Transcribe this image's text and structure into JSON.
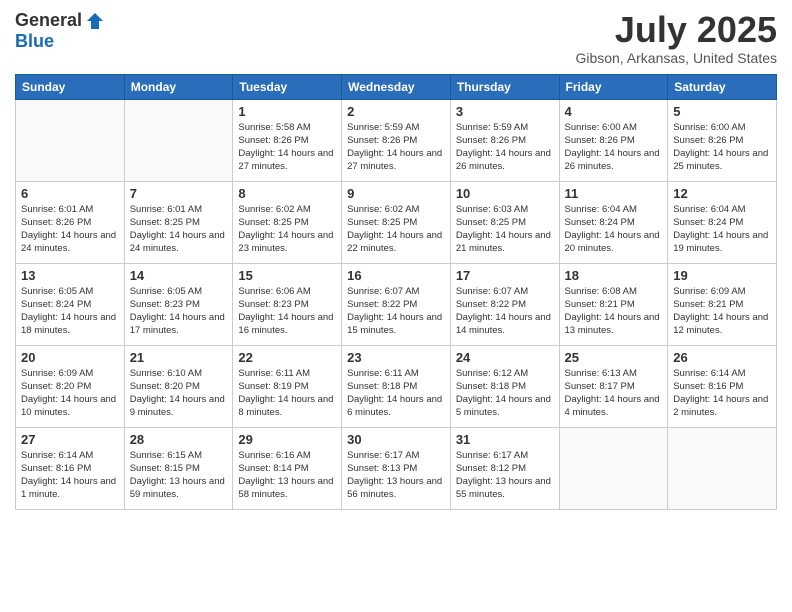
{
  "header": {
    "logo_general": "General",
    "logo_blue": "Blue",
    "month_title": "July 2025",
    "location": "Gibson, Arkansas, United States"
  },
  "weekdays": [
    "Sunday",
    "Monday",
    "Tuesday",
    "Wednesday",
    "Thursday",
    "Friday",
    "Saturday"
  ],
  "weeks": [
    [
      {
        "day": "",
        "sunrise": "",
        "sunset": "",
        "daylight": ""
      },
      {
        "day": "",
        "sunrise": "",
        "sunset": "",
        "daylight": ""
      },
      {
        "day": "1",
        "sunrise": "Sunrise: 5:58 AM",
        "sunset": "Sunset: 8:26 PM",
        "daylight": "Daylight: 14 hours and 27 minutes."
      },
      {
        "day": "2",
        "sunrise": "Sunrise: 5:59 AM",
        "sunset": "Sunset: 8:26 PM",
        "daylight": "Daylight: 14 hours and 27 minutes."
      },
      {
        "day": "3",
        "sunrise": "Sunrise: 5:59 AM",
        "sunset": "Sunset: 8:26 PM",
        "daylight": "Daylight: 14 hours and 26 minutes."
      },
      {
        "day": "4",
        "sunrise": "Sunrise: 6:00 AM",
        "sunset": "Sunset: 8:26 PM",
        "daylight": "Daylight: 14 hours and 26 minutes."
      },
      {
        "day": "5",
        "sunrise": "Sunrise: 6:00 AM",
        "sunset": "Sunset: 8:26 PM",
        "daylight": "Daylight: 14 hours and 25 minutes."
      }
    ],
    [
      {
        "day": "6",
        "sunrise": "Sunrise: 6:01 AM",
        "sunset": "Sunset: 8:26 PM",
        "daylight": "Daylight: 14 hours and 24 minutes."
      },
      {
        "day": "7",
        "sunrise": "Sunrise: 6:01 AM",
        "sunset": "Sunset: 8:25 PM",
        "daylight": "Daylight: 14 hours and 24 minutes."
      },
      {
        "day": "8",
        "sunrise": "Sunrise: 6:02 AM",
        "sunset": "Sunset: 8:25 PM",
        "daylight": "Daylight: 14 hours and 23 minutes."
      },
      {
        "day": "9",
        "sunrise": "Sunrise: 6:02 AM",
        "sunset": "Sunset: 8:25 PM",
        "daylight": "Daylight: 14 hours and 22 minutes."
      },
      {
        "day": "10",
        "sunrise": "Sunrise: 6:03 AM",
        "sunset": "Sunset: 8:25 PM",
        "daylight": "Daylight: 14 hours and 21 minutes."
      },
      {
        "day": "11",
        "sunrise": "Sunrise: 6:04 AM",
        "sunset": "Sunset: 8:24 PM",
        "daylight": "Daylight: 14 hours and 20 minutes."
      },
      {
        "day": "12",
        "sunrise": "Sunrise: 6:04 AM",
        "sunset": "Sunset: 8:24 PM",
        "daylight": "Daylight: 14 hours and 19 minutes."
      }
    ],
    [
      {
        "day": "13",
        "sunrise": "Sunrise: 6:05 AM",
        "sunset": "Sunset: 8:24 PM",
        "daylight": "Daylight: 14 hours and 18 minutes."
      },
      {
        "day": "14",
        "sunrise": "Sunrise: 6:05 AM",
        "sunset": "Sunset: 8:23 PM",
        "daylight": "Daylight: 14 hours and 17 minutes."
      },
      {
        "day": "15",
        "sunrise": "Sunrise: 6:06 AM",
        "sunset": "Sunset: 8:23 PM",
        "daylight": "Daylight: 14 hours and 16 minutes."
      },
      {
        "day": "16",
        "sunrise": "Sunrise: 6:07 AM",
        "sunset": "Sunset: 8:22 PM",
        "daylight": "Daylight: 14 hours and 15 minutes."
      },
      {
        "day": "17",
        "sunrise": "Sunrise: 6:07 AM",
        "sunset": "Sunset: 8:22 PM",
        "daylight": "Daylight: 14 hours and 14 minutes."
      },
      {
        "day": "18",
        "sunrise": "Sunrise: 6:08 AM",
        "sunset": "Sunset: 8:21 PM",
        "daylight": "Daylight: 14 hours and 13 minutes."
      },
      {
        "day": "19",
        "sunrise": "Sunrise: 6:09 AM",
        "sunset": "Sunset: 8:21 PM",
        "daylight": "Daylight: 14 hours and 12 minutes."
      }
    ],
    [
      {
        "day": "20",
        "sunrise": "Sunrise: 6:09 AM",
        "sunset": "Sunset: 8:20 PM",
        "daylight": "Daylight: 14 hours and 10 minutes."
      },
      {
        "day": "21",
        "sunrise": "Sunrise: 6:10 AM",
        "sunset": "Sunset: 8:20 PM",
        "daylight": "Daylight: 14 hours and 9 minutes."
      },
      {
        "day": "22",
        "sunrise": "Sunrise: 6:11 AM",
        "sunset": "Sunset: 8:19 PM",
        "daylight": "Daylight: 14 hours and 8 minutes."
      },
      {
        "day": "23",
        "sunrise": "Sunrise: 6:11 AM",
        "sunset": "Sunset: 8:18 PM",
        "daylight": "Daylight: 14 hours and 6 minutes."
      },
      {
        "day": "24",
        "sunrise": "Sunrise: 6:12 AM",
        "sunset": "Sunset: 8:18 PM",
        "daylight": "Daylight: 14 hours and 5 minutes."
      },
      {
        "day": "25",
        "sunrise": "Sunrise: 6:13 AM",
        "sunset": "Sunset: 8:17 PM",
        "daylight": "Daylight: 14 hours and 4 minutes."
      },
      {
        "day": "26",
        "sunrise": "Sunrise: 6:14 AM",
        "sunset": "Sunset: 8:16 PM",
        "daylight": "Daylight: 14 hours and 2 minutes."
      }
    ],
    [
      {
        "day": "27",
        "sunrise": "Sunrise: 6:14 AM",
        "sunset": "Sunset: 8:16 PM",
        "daylight": "Daylight: 14 hours and 1 minute."
      },
      {
        "day": "28",
        "sunrise": "Sunrise: 6:15 AM",
        "sunset": "Sunset: 8:15 PM",
        "daylight": "Daylight: 13 hours and 59 minutes."
      },
      {
        "day": "29",
        "sunrise": "Sunrise: 6:16 AM",
        "sunset": "Sunset: 8:14 PM",
        "daylight": "Daylight: 13 hours and 58 minutes."
      },
      {
        "day": "30",
        "sunrise": "Sunrise: 6:17 AM",
        "sunset": "Sunset: 8:13 PM",
        "daylight": "Daylight: 13 hours and 56 minutes."
      },
      {
        "day": "31",
        "sunrise": "Sunrise: 6:17 AM",
        "sunset": "Sunset: 8:12 PM",
        "daylight": "Daylight: 13 hours and 55 minutes."
      },
      {
        "day": "",
        "sunrise": "",
        "sunset": "",
        "daylight": ""
      },
      {
        "day": "",
        "sunrise": "",
        "sunset": "",
        "daylight": ""
      }
    ]
  ]
}
